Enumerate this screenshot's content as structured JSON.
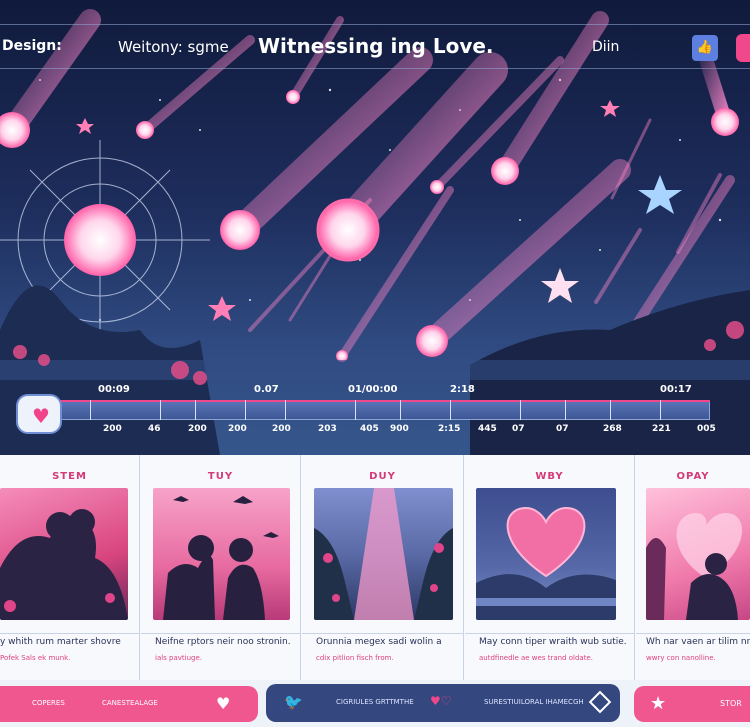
{
  "header": {
    "design": "Design:",
    "weitony": "Weitony: sgme",
    "title": "Witnessing ing Love.",
    "diin": "Diin"
  },
  "timeline": {
    "top_labels": [
      "00:09",
      "0.07",
      "01/00:00",
      "2:18",
      "00:17"
    ],
    "bottom_labels": [
      "200",
      "46",
      "200",
      "200",
      "200",
      "203",
      "405",
      "900",
      "2:15",
      "445",
      "07",
      "07",
      "268",
      "221",
      "005"
    ]
  },
  "cards": [
    {
      "heading": "STEM",
      "line1": "y whith rum marter shovre",
      "line2": "Pofek Sals ek munk."
    },
    {
      "heading": "TUY",
      "line1": "Neifne rptors neir noo stronin.",
      "line2": "ials pavtiuge."
    },
    {
      "heading": "DUY",
      "line1": "Orunnia megex sadi wolin a",
      "line2": "cdix pitlion fisch from."
    },
    {
      "heading": "WBY",
      "line1": "May conn tiper wraith wub sutie.",
      "line2": "autdfinedle ae wes trand oldate."
    },
    {
      "heading": "OPAY",
      "line1": "Wh nar vaen ar tilim nrys",
      "line2": "wwry con nanolline."
    }
  ],
  "bottom": {
    "left_text1": "COPERES",
    "left_text2": "CANESTEALAGE",
    "mid_text1": "CIGRIULES GRTTMTHE",
    "mid_text2": "SURESTIUILORAL IHAMECGH",
    "right_text": "STOR"
  },
  "colors": {
    "accent": "#f0488a",
    "navy": "#34477f",
    "sky": "#101a3c"
  }
}
